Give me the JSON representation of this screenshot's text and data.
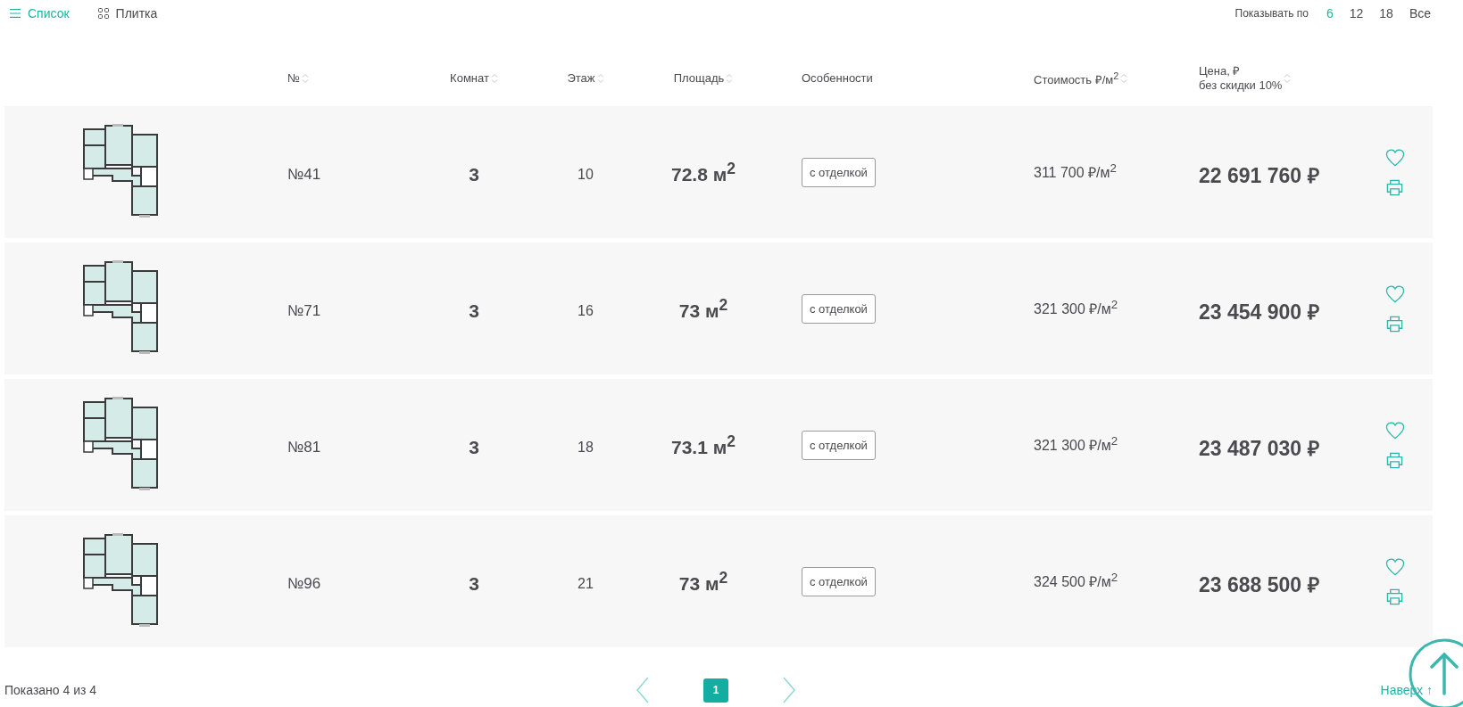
{
  "view_modes": [
    {
      "label": "Список",
      "selected": true
    },
    {
      "label": "Плитка",
      "selected": false
    }
  ],
  "page_size": {
    "label": "Показывать по",
    "options": [
      {
        "label": "6",
        "selected": true
      },
      {
        "label": "12",
        "selected": false
      },
      {
        "label": "18",
        "selected": false
      },
      {
        "label": "Все",
        "selected": false
      }
    ]
  },
  "columns": [
    {
      "label": "№",
      "sortable": true
    },
    {
      "label": "Комнат",
      "sortable": true
    },
    {
      "label": "Этаж",
      "sortable": true
    },
    {
      "label": "Площадь",
      "sortable": true
    },
    {
      "label": "Особенности",
      "sortable": false
    },
    {
      "label": "Стоимость ₽/м$^{2}$",
      "sortable": true
    },
    {
      "label": "Цена,  ₽\nбез скидки 10%",
      "sortable": true
    }
  ],
  "rows": [
    {
      "number": "№41",
      "rooms": "3",
      "floor": "10",
      "area": "72.8 м$^{2}$",
      "feature": "с отделкой",
      "price_per_m2": "311 700 ₽/м$^{2}$",
      "price": "22 691 760 ₽"
    },
    {
      "number": "№71",
      "rooms": "3",
      "floor": "16",
      "area": "73 м$^{2}$",
      "feature": "с отделкой",
      "price_per_m2": "321 300 ₽/м$^{2}$",
      "price": "23 454 900 ₽"
    },
    {
      "number": "№81",
      "rooms": "3",
      "floor": "18",
      "area": "73.1 м$^{2}$",
      "feature": "с отделкой",
      "price_per_m2": "321 300 ₽/м$^{2}$",
      "price": "23 487 030 ₽"
    },
    {
      "number": "№96",
      "rooms": "3",
      "floor": "21",
      "area": "73 м$^{2}$",
      "feature": "с отделкой",
      "price_per_m2": "324 500 ₽/м$^{2}$",
      "price": "23 688 500 ₽"
    }
  ],
  "footer": {
    "shown": "Показано 4 из 4",
    "pages": [
      {
        "label": "1",
        "selected": true
      }
    ],
    "to_top": "Наверх ↑"
  }
}
